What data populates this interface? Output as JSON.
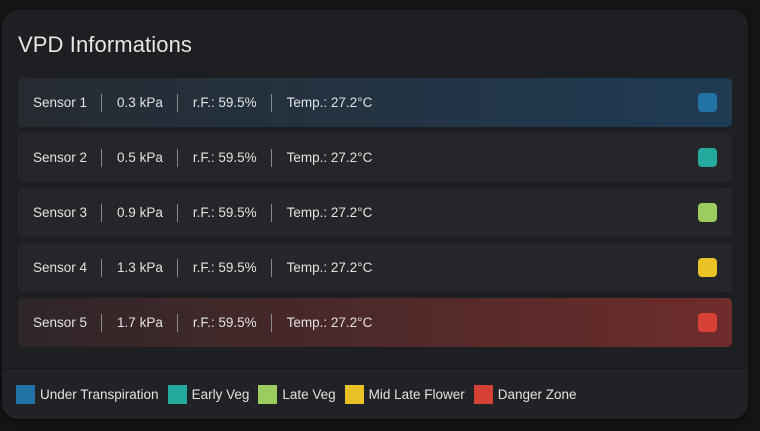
{
  "card": {
    "title": "VPD Informations"
  },
  "sensors": [
    {
      "name": "Sensor 1",
      "vpd": "0.3 kPa",
      "rh": "r.F.: 59.5%",
      "temp": "Temp.: 27.2°C",
      "color": "#2272a6",
      "bg": "linear-gradient(90deg, #262b31 0%, #1f3b54 100%)"
    },
    {
      "name": "Sensor 2",
      "vpd": "0.5 kPa",
      "rh": "r.F.: 59.5%",
      "temp": "Temp.: 27.2°C",
      "color": "#24aa9c",
      "bg": "#25262a"
    },
    {
      "name": "Sensor 3",
      "vpd": "0.9 kPa",
      "rh": "r.F.: 59.5%",
      "temp": "Temp.: 27.2°C",
      "color": "#9ccc60",
      "bg": "#25262a"
    },
    {
      "name": "Sensor 4",
      "vpd": "1.3 kPa",
      "rh": "r.F.: 59.5%",
      "temp": "Temp.: 27.2°C",
      "color": "#e8c227",
      "bg": "#25262a"
    },
    {
      "name": "Sensor 5",
      "vpd": "1.7 kPa",
      "rh": "r.F.: 59.5%",
      "temp": "Temp.: 27.2°C",
      "color": "#d64135",
      "bg": "linear-gradient(90deg, #2e2628 0%, #6e2c2b 100%)"
    }
  ],
  "legend": [
    {
      "label": "Under Transpiration",
      "color": "#2272a6"
    },
    {
      "label": "Early Veg",
      "color": "#24aa9c"
    },
    {
      "label": "Late Veg",
      "color": "#9ccc60"
    },
    {
      "label": "Mid Late Flower",
      "color": "#e8c227"
    },
    {
      "label": "Danger Zone",
      "color": "#d64135"
    }
  ]
}
